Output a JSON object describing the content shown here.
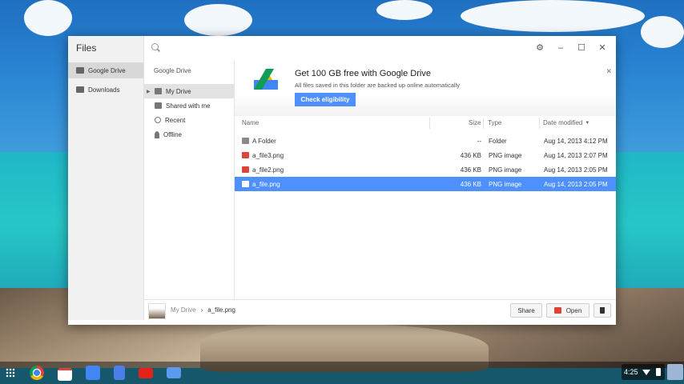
{
  "app": {
    "title": "Files"
  },
  "nav": {
    "items": [
      {
        "label": "Google Drive",
        "icon": "drive-icon"
      },
      {
        "label": "Downloads",
        "icon": "downloads-icon"
      }
    ]
  },
  "topbar": {
    "search_placeholder": ""
  },
  "tree": {
    "header": "Google Drive",
    "items": [
      {
        "label": "My Drive",
        "icon": "drive-icon"
      },
      {
        "label": "Shared with me",
        "icon": "people-icon"
      },
      {
        "label": "Recent",
        "icon": "clock-icon"
      },
      {
        "label": "Offline",
        "icon": "pin-icon"
      }
    ]
  },
  "banner": {
    "title": "Get 100 GB free with Google Drive",
    "subtitle": "All files saved in this folder are backed up online automatically",
    "button": "Check eligibility"
  },
  "columns": {
    "name": "Name",
    "size": "Size",
    "type": "Type",
    "date": "Date modified"
  },
  "files": [
    {
      "name": "A Folder",
      "size": "--",
      "type": "Folder",
      "date": "Aug 14, 2013 4:12 PM",
      "icon": "folder-icon"
    },
    {
      "name": "a_file3.png",
      "size": "436 KB",
      "type": "PNG image",
      "date": "Aug 14, 2013 2:07 PM",
      "icon": "image-icon"
    },
    {
      "name": "a_file2.png",
      "size": "436 KB",
      "type": "PNG image",
      "date": "Aug 14, 2013 2:05 PM",
      "icon": "image-icon"
    },
    {
      "name": "a_file.png",
      "size": "436 KB",
      "type": "PNG image",
      "date": "Aug 14, 2013 2:05 PM",
      "icon": "image-icon"
    }
  ],
  "bottombar": {
    "breadcrumb": [
      "My Drive",
      "a_file.png"
    ],
    "share_label": "Share",
    "open_label": "Open"
  },
  "shelf": {
    "clock": "4:25",
    "apps": [
      "chrome-icon",
      "gmail-icon",
      "google-search-icon",
      "docs-icon",
      "youtube-icon",
      "files-icon"
    ]
  },
  "colors": {
    "accent": "#4d90fe",
    "selection": "#4d90fe",
    "image_icon": "#db4437"
  }
}
